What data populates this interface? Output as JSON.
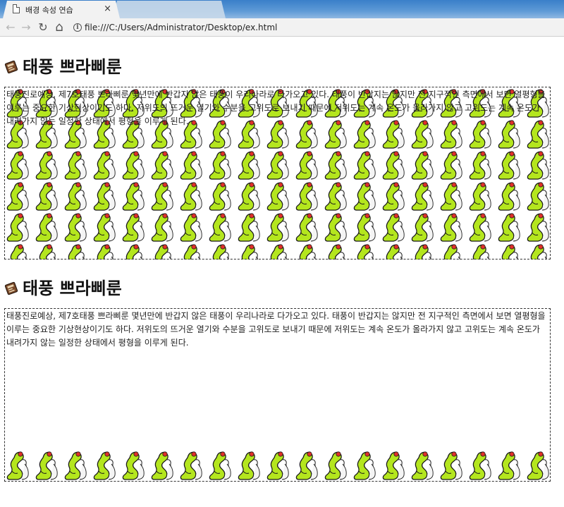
{
  "browser": {
    "tabs": [
      {
        "title": "배경 속성 연습",
        "active": true
      },
      {
        "title": "",
        "active": false
      }
    ],
    "close_glyph": "×",
    "back_glyph": "←",
    "forward_glyph": "→",
    "reload_glyph": "↻",
    "home_glyph": "⌂",
    "info_glyph": "i",
    "url": "file:///C:/Users/Administrator/Desktop/ex.html"
  },
  "sections": [
    {
      "heading": "태풍 쁘라삐룬",
      "icon": "magazine-icon",
      "paragraph": "태풍진로예상, 제7호태풍 쁘라삐룬 몇년만에 반갑지 않은 태풍이 우리나라로 다가오고 있다. 태풍이 반갑지는 않지만 전 지구적인 측면에서 보면 열평형을 이루는 중요한 기상현상이기도 하다. 저위도의 뜨거운 열기와 수분을 고위도로 보내기 때문에 저위도는 계속 온도가 올라가지 않고 고위도는 계속 온도가 내려가지 않는 일정한 상태에서 평형을 이루게 된다.",
      "background": "repeat"
    },
    {
      "heading": "태풍 쁘라삐룬",
      "icon": "magazine-icon",
      "paragraph": "태풍진로예상, 제7호태풍 쁘라삐룬 몇년만에 반갑지 않은 태풍이 우리나라로 다가오고 있다. 태풍이 반갑지는 않지만 전 지구적인 측면에서 보면 열평형을 이루는 중요한 기상현상이기도 하다. 저위도의 뜨거운 열기와 수분을 고위도로 보내기 때문에 저위도는 계속 온도가 올라가지 않고 고위도는 계속 온도가 내려가지 않는 일정한 상태에서 평형을 이루게 된다.",
      "background": "repeat-x bottom"
    }
  ],
  "colors": {
    "pattern_green": "#b4e61e",
    "pattern_red": "#e0302a",
    "tab_bar_blue": "#3a7fc9"
  }
}
